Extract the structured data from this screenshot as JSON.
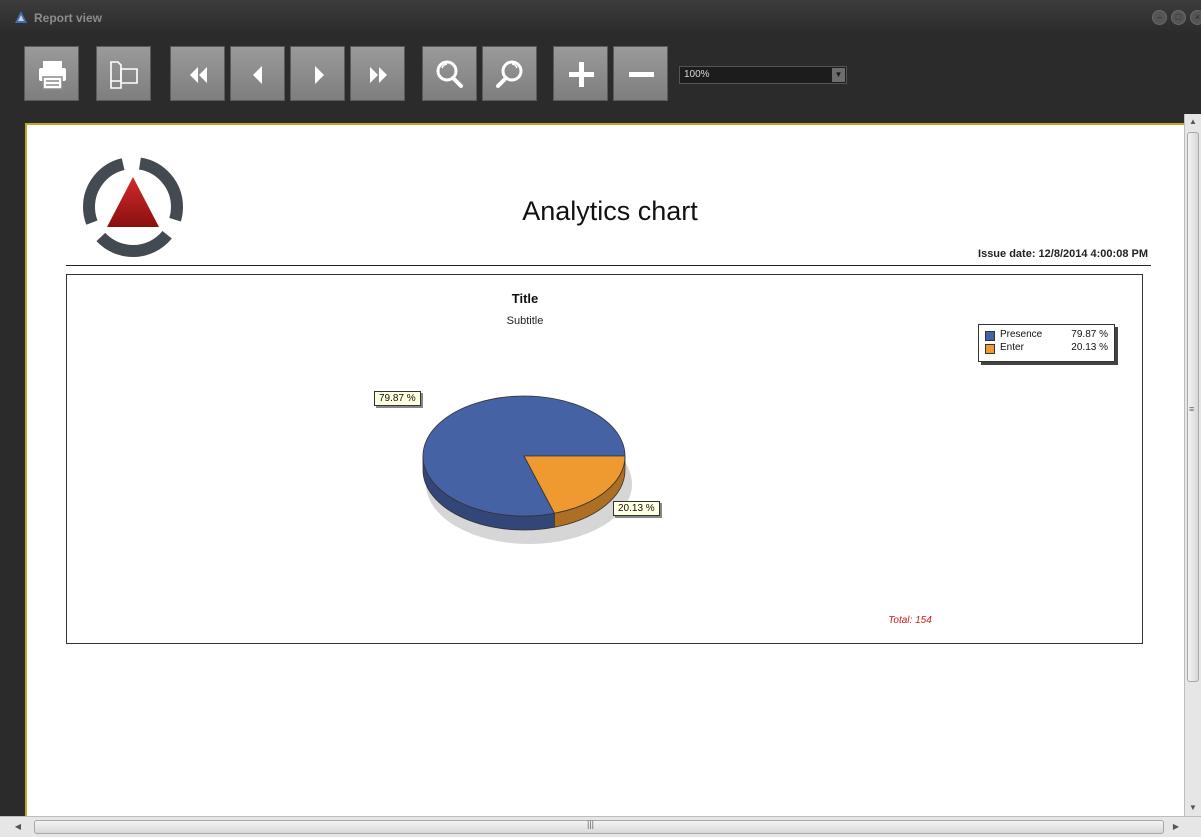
{
  "window": {
    "title": "Report view"
  },
  "toolbar": {
    "buttons": [
      {
        "name": "print-button",
        "icon": "printer-icon"
      },
      {
        "name": "page-setup-button",
        "icon": "page-setup-icon"
      },
      {
        "name": "first-page-button",
        "icon": "first-page-icon"
      },
      {
        "name": "previous-page-button",
        "icon": "previous-page-icon"
      },
      {
        "name": "next-page-button",
        "icon": "next-page-icon"
      },
      {
        "name": "last-page-button",
        "icon": "last-page-icon"
      },
      {
        "name": "zoom-in-button",
        "icon": "magnifier-icon"
      },
      {
        "name": "zoom-out-button",
        "icon": "magnifier-icon"
      },
      {
        "name": "increase-button",
        "icon": "plus-icon"
      },
      {
        "name": "decrease-button",
        "icon": "minus-icon"
      }
    ],
    "zoom": {
      "value": "100%"
    }
  },
  "report": {
    "title": "Analytics chart",
    "issue_date": "Issue date: 12/8/2014 4:00:08 PM",
    "logo": "triangle-logo-icon"
  },
  "chart_data": {
    "type": "pie",
    "title": "Title",
    "subtitle": "Subtitle",
    "categories": [
      "Presence",
      "Enter"
    ],
    "values": [
      79.87,
      20.13
    ],
    "labels": [
      "79.87 %",
      "20.13 %"
    ],
    "legend": [
      {
        "name": "Presence",
        "value": "79.87 %",
        "color": "#4562a5"
      },
      {
        "name": "Enter",
        "value": "20.13 %",
        "color": "#ef9a31"
      }
    ],
    "legend_position": "top-right",
    "total": "Total: 154",
    "colors": {
      "Presence": "#4562a5",
      "Enter": "#ef9a31"
    }
  }
}
